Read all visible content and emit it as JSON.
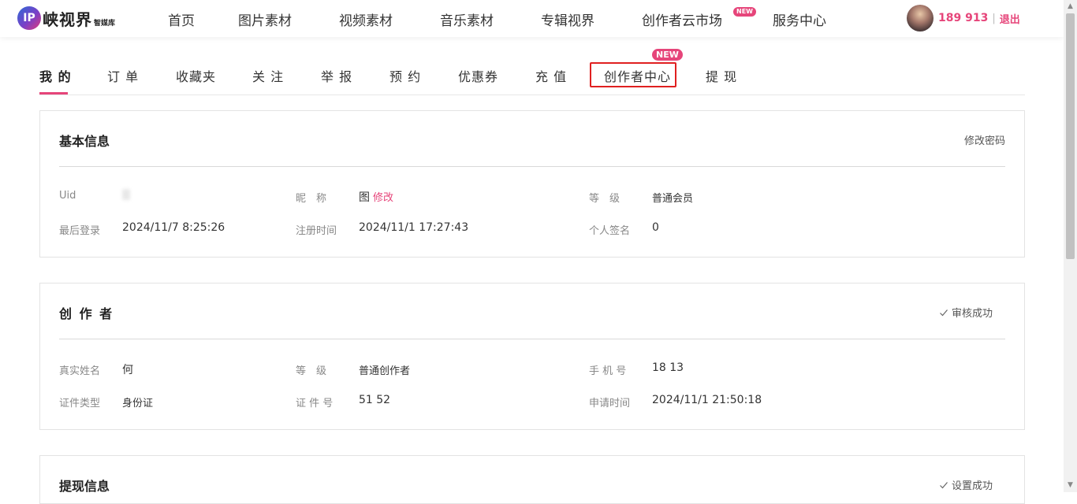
{
  "header": {
    "logo_mark": "IP",
    "logo_text": "峡视界",
    "logo_sub": "智媒库",
    "nav": [
      {
        "label": "首页"
      },
      {
        "label": "图片素材"
      },
      {
        "label": "视频素材"
      },
      {
        "label": "音乐素材"
      },
      {
        "label": "专辑视界"
      },
      {
        "label": "创作者云市场",
        "badge": "NEW"
      },
      {
        "label": "服务中心"
      }
    ],
    "user_phone": "189     913",
    "separator": "|",
    "logout_label": "退出"
  },
  "tabs": [
    {
      "label": "我 的",
      "active": true
    },
    {
      "label": "订 单"
    },
    {
      "label": "收藏夹"
    },
    {
      "label": "关 注"
    },
    {
      "label": "举 报"
    },
    {
      "label": "预 约"
    },
    {
      "label": "优惠券"
    },
    {
      "label": "充 值"
    },
    {
      "label": "创作者中心",
      "badge": "NEW",
      "highlighted": true
    },
    {
      "label": "提 现"
    }
  ],
  "basic_info": {
    "title": "基本信息",
    "action": "修改密码",
    "uid_label": "Uid",
    "uid_value": "",
    "nickname_label": "昵　称",
    "nickname_value": "图",
    "nickname_edit": "修改",
    "level_label": "等　级",
    "level_value": "普通会员",
    "last_login_label": "最后登录",
    "last_login_value": "2024/11/7 8:25:26",
    "register_label": "注册时间",
    "register_value": "2024/11/1 17:27:43",
    "signature_label": "个人签名",
    "signature_value": "0"
  },
  "creator": {
    "title": "创 作 者",
    "status": "审核成功",
    "realname_label": "真实姓名",
    "realname_value": "何",
    "level_label": "等　级",
    "level_value": "普通创作者",
    "phone_label": "手 机 号",
    "phone_value": "18     13",
    "idtype_label": "证件类型",
    "idtype_value": "身份证",
    "idno_label": "证 件 号",
    "idno_value": "51     52",
    "apply_label": "申请时间",
    "apply_value": "2024/11/1 21:50:18"
  },
  "withdraw": {
    "title": "提现信息",
    "status": "设置成功"
  },
  "colors": {
    "accent": "#e6457a",
    "highlight_border": "#e02020"
  }
}
